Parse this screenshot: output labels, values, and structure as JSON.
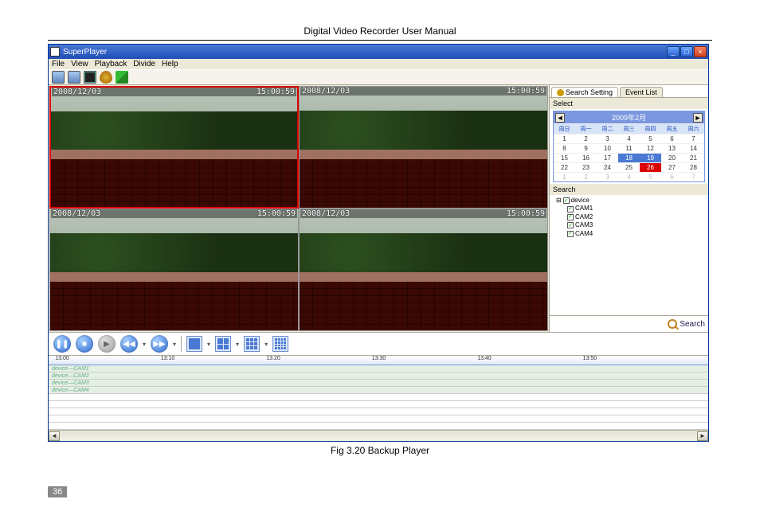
{
  "doc": {
    "header": "Digital Video Recorder User Manual",
    "caption": "Fig 3.20 Backup Player",
    "page_number": "36"
  },
  "titlebar": {
    "app_name": "SuperPlayer",
    "minimize": "_",
    "maximize": "□",
    "close": "×"
  },
  "menubar": {
    "items": [
      "File",
      "View",
      "Playback",
      "Divide",
      "Help"
    ]
  },
  "osd": {
    "date": "2008/12/03",
    "time": "15:00:59"
  },
  "side": {
    "tab_search": "Search Setting",
    "tab_event": "Event List",
    "section_select": "Select",
    "section_search": "Search",
    "search_button": "Search"
  },
  "calendar": {
    "title": "2009年2月",
    "prev": "◄",
    "next": "►",
    "dow": [
      "周日",
      "周一",
      "周二",
      "周三",
      "周四",
      "周五",
      "周六"
    ],
    "rows": [
      [
        "1",
        "2",
        "3",
        "4",
        "5",
        "6",
        "7"
      ],
      [
        "8",
        "9",
        "10",
        "11",
        "12",
        "13",
        "14"
      ],
      [
        "15",
        "16",
        "17",
        "18",
        "19",
        "20",
        "21"
      ],
      [
        "22",
        "23",
        "24",
        "25",
        "26",
        "27",
        "28"
      ],
      [
        "1",
        "2",
        "3",
        "4",
        "5",
        "6",
        "7"
      ]
    ],
    "highlight_row_index": 3,
    "selected_cell": "26"
  },
  "tree": {
    "device": "device",
    "cams": [
      "CAM1",
      "CAM2",
      "CAM3",
      "CAM4"
    ]
  },
  "timeline": {
    "ticks": [
      {
        "pos": "1%",
        "label": "13:00"
      },
      {
        "pos": "17%",
        "label": "13:10"
      },
      {
        "pos": "33%",
        "label": "13:20"
      },
      {
        "pos": "49%",
        "label": "13:30"
      },
      {
        "pos": "65%",
        "label": "13:40"
      },
      {
        "pos": "81%",
        "label": "13:50"
      }
    ],
    "rows": [
      "device—CAM1",
      "device—CAM2",
      "device—CAM3",
      "device—CAM4"
    ]
  }
}
